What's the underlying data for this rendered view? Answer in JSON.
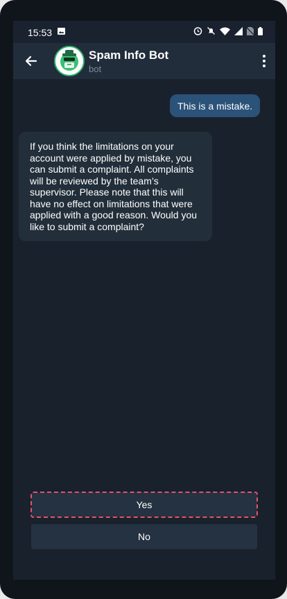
{
  "status_bar": {
    "time": "15:53"
  },
  "header": {
    "title": "Spam Info Bot",
    "subtitle": "bot"
  },
  "messages": [
    {
      "direction": "out",
      "text": "This is a mistake."
    },
    {
      "direction": "in",
      "text": "If you think the limitations on your account were applied by mistake, you can submit a complaint. All complaints will be reviewed by the team’s supervisor. Please note that this will have no effect on limitations that were applied with a good reason. Would you like to submit a complaint?"
    }
  ],
  "keyboard": {
    "buttons": [
      {
        "label": "Yes"
      },
      {
        "label": "No"
      }
    ]
  },
  "colors": {
    "background": "#19212c",
    "appbar": "#212d3b",
    "outgoing_bubble": "#2b5278",
    "incoming_bubble": "#222e3a",
    "focus_outline": "#e8516d"
  }
}
